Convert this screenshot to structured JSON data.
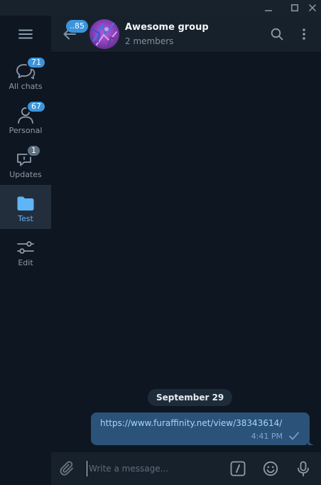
{
  "window": {
    "controls": [
      "minimize-icon",
      "maximize-icon",
      "close-icon"
    ]
  },
  "sidebar": {
    "menu_icon": "hamburger-icon",
    "folders": [
      {
        "label": "All chats",
        "badge": "71",
        "icon": "chats-icon",
        "badge_muted": false,
        "active": false
      },
      {
        "label": "Personal",
        "badge": "67",
        "icon": "person-icon",
        "badge_muted": false,
        "active": false
      },
      {
        "label": "Updates",
        "badge": "1",
        "icon": "updates-icon",
        "badge_muted": true,
        "active": false
      },
      {
        "label": "Test",
        "badge": "",
        "icon": "folder-icon",
        "badge_muted": false,
        "active": true
      },
      {
        "label": "Edit",
        "badge": "",
        "icon": "edit-sliders-icon",
        "badge_muted": false,
        "active": false
      }
    ]
  },
  "header": {
    "back_badge": "..85",
    "title": "Awesome group",
    "subtitle": "2 members",
    "icons": [
      "search-icon",
      "more-vertical-icon"
    ]
  },
  "messages": {
    "date": "September 29",
    "items": [
      {
        "text": "https://www.furaffinity.net/view/38343614/",
        "time": "4:41 PM",
        "status": "sent"
      }
    ]
  },
  "composer": {
    "placeholder": "Write a message...",
    "value": "",
    "icons": [
      "attach-icon",
      "commands-icon",
      "emoji-icon",
      "microphone-icon"
    ]
  },
  "colors": {
    "background": "#0e1621",
    "panel": "#17212b",
    "accent": "#5eb5f7",
    "badge": "#3d94db",
    "bubble_out": "#2b5278"
  }
}
